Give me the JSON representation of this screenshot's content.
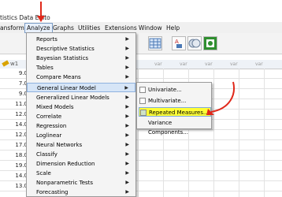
{
  "window": {
    "title": "tistics Data Edito"
  },
  "menubar": {
    "items": [
      {
        "label": "ansform"
      },
      {
        "label": "Analyze"
      },
      {
        "label": "Graphs"
      },
      {
        "label": "Utilities"
      },
      {
        "label": "Extensions"
      },
      {
        "label": "Window"
      },
      {
        "label": "Help"
      }
    ]
  },
  "grid": {
    "column": "w1",
    "var_label": "var",
    "rows": [
      "9.0",
      "7.0",
      "9.0",
      "11.0",
      "12.0",
      "14.0",
      "12.0",
      "17.0",
      "18.0",
      "19.0",
      "14.0",
      "13.0"
    ]
  },
  "analyze_menu": {
    "items": [
      {
        "label": "Reports",
        "submenu": true
      },
      {
        "label": "Descriptive Statistics",
        "submenu": true
      },
      {
        "label": "Bayesian Statistics",
        "submenu": true
      },
      {
        "label": "Tables",
        "submenu": true
      },
      {
        "label": "Compare Means",
        "submenu": true
      },
      {
        "label": "General Linear Model",
        "submenu": true
      },
      {
        "label": "Generalized Linear Models",
        "submenu": true
      },
      {
        "label": "Mixed Models",
        "submenu": true
      },
      {
        "label": "Correlate",
        "submenu": true
      },
      {
        "label": "Regression",
        "submenu": true
      },
      {
        "label": "Loglinear",
        "submenu": true
      },
      {
        "label": "Neural Networks",
        "submenu": true
      },
      {
        "label": "Classify",
        "submenu": true
      },
      {
        "label": "Dimension Reduction",
        "submenu": true
      },
      {
        "label": "Scale",
        "submenu": true
      },
      {
        "label": "Nonparametric Tests",
        "submenu": true
      },
      {
        "label": "Forecasting",
        "submenu": true
      }
    ]
  },
  "glm_submenu": {
    "items": [
      {
        "label": "Univariate..."
      },
      {
        "label": "Multivariate..."
      },
      {
        "label": "Repeated Measures..."
      },
      {
        "label": "Variance Components..."
      }
    ]
  },
  "colors": {
    "annotation_arrow": "#e0281a",
    "highlight": "#ffff36",
    "selection": "#d6e5f7"
  }
}
